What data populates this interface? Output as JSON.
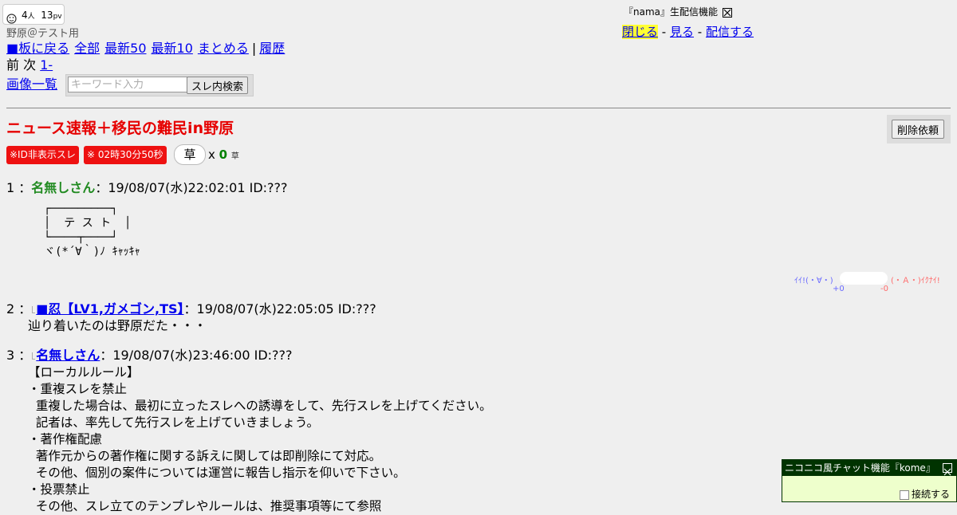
{
  "counter": {
    "people": "4",
    "people_unit": "人",
    "pv": "13",
    "pv_unit": "pv"
  },
  "board_name": "野原＠テスト用",
  "nav": {
    "back": "■板に戻る",
    "all": "全部",
    "latest50": "最新50",
    "latest10": "最新10",
    "summarize": "まとめる",
    "separator": "|",
    "history": "履歴"
  },
  "pager": {
    "prev": "前",
    "next": "次",
    "range": "1-"
  },
  "image_list": "画像一覧",
  "search": {
    "placeholder": "キーワード入力",
    "button": "スレ内検索"
  },
  "nama": {
    "title": "『nama』生配信機能",
    "close": "閉じる",
    "watch": "見る",
    "broadcast": "配信する",
    "dash": "-"
  },
  "thread": {
    "title": "ニュース速報＋移民の難民in野原",
    "delete_request": "削除依頼",
    "badge_id_hidden": "※ID非表示スレ",
    "badge_time": "※ 02時30分50秒",
    "kusa_label": "草",
    "kusa_prefix": "x",
    "kusa_count": "0",
    "kusa_suffix": "草"
  },
  "posts": [
    {
      "number": "1",
      "sep": "：",
      "name": "名無しさん",
      "date": "：19/08/07(水)22:02:01 ID:???",
      "aa": "┌─────────┐\n│  テ ス ト  │\n└────┬────┘\nヾ(*´∀｀)ﾉ ｷｬｯｷｬ"
    },
    {
      "number": "2",
      "sep": "：",
      "name": "■忍【LV1,ガメゴン,TS】",
      "date": "：19/08/07(水)22:05:05 ID:???",
      "body": "辿り着いたのは野原だた・・・"
    },
    {
      "number": "3",
      "sep": "：",
      "name": "名無しさん",
      "date": "：19/08/07(水)23:46:00 ID:???",
      "body": "【ローカルルール】\n・重複スレを禁止\n  重複した場合は、最初に立ったスレへの誘導をして、先行スレを上げてください。\n  記者は、率先して先行スレを上げていきましょう。\n・著作権配慮\n  著作元からの著作権に関する訴えに関しては即削除にて対応。\n  その他、個別の案件については運営に報告し指示を仰いで下さい。\n・投票禁止\n  その他、スレ立てのテンプレやルールは、推奨事項等にて参照"
    }
  ],
  "vote": {
    "good": "ｲｲ!(・∀・)",
    "bad": "(・Ａ・)ｲｸﾅｲ!",
    "plus": "+0",
    "minus": "-0"
  },
  "chat": {
    "title": "ニコニコ風チャット機能『kome』",
    "connect": "接続する"
  },
  "colors": {
    "title_red": "#e60000",
    "badge_red": "#ee1111",
    "name_green": "#228b22",
    "link_blue": "#0000ee",
    "highlight": "#ffff33",
    "chat_header": "#003300"
  }
}
